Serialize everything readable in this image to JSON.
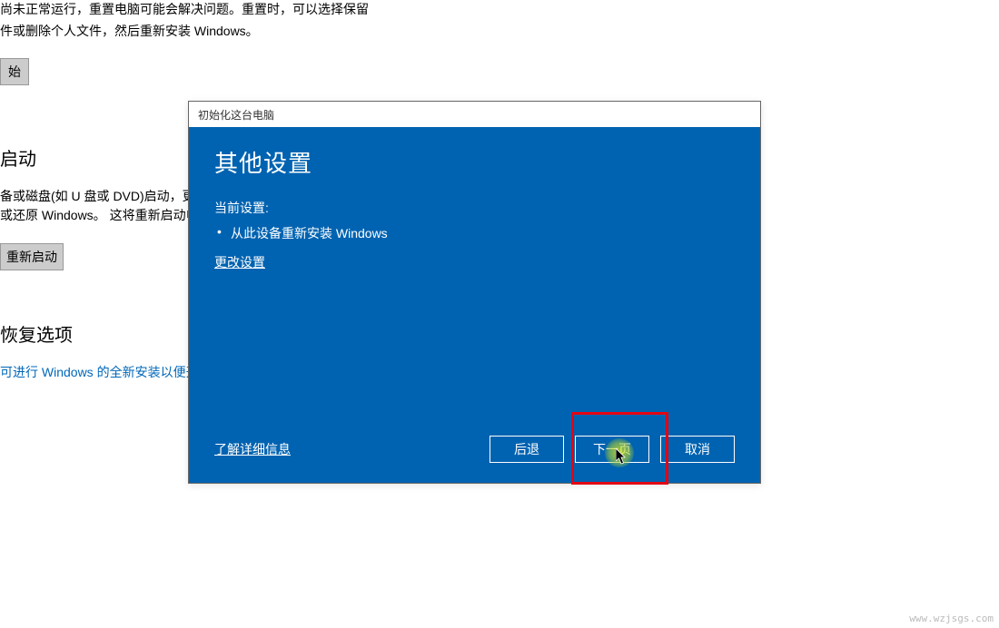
{
  "background": {
    "text1": "尚未正常运行，重置电脑可能会解决问题。重置时，可以选择保留",
    "text2": "件或删除个人文件，然后重新安装 Windows。",
    "button_start": "始",
    "heading1": "启动",
    "text3": "备或磁盘(如 U 盘或 DVD)启动，更改 W",
    "text4": "或还原 Windows。  这将重新启动电脑",
    "button_restart": "重新启动",
    "heading2": "恢复选项",
    "link": "可进行 Windows 的全新安装以便开始"
  },
  "dialog": {
    "titlebar": "初始化这台电脑",
    "title": "其他设置",
    "current_settings_label": "当前设置:",
    "settings_item": "从此设备重新安装 Windows",
    "change_link": "更改设置",
    "learn_more": "了解详细信息",
    "btn_back": "后退",
    "btn_next": "下一页",
    "btn_cancel": "取消"
  },
  "watermark": "www.wzjsgs.com"
}
